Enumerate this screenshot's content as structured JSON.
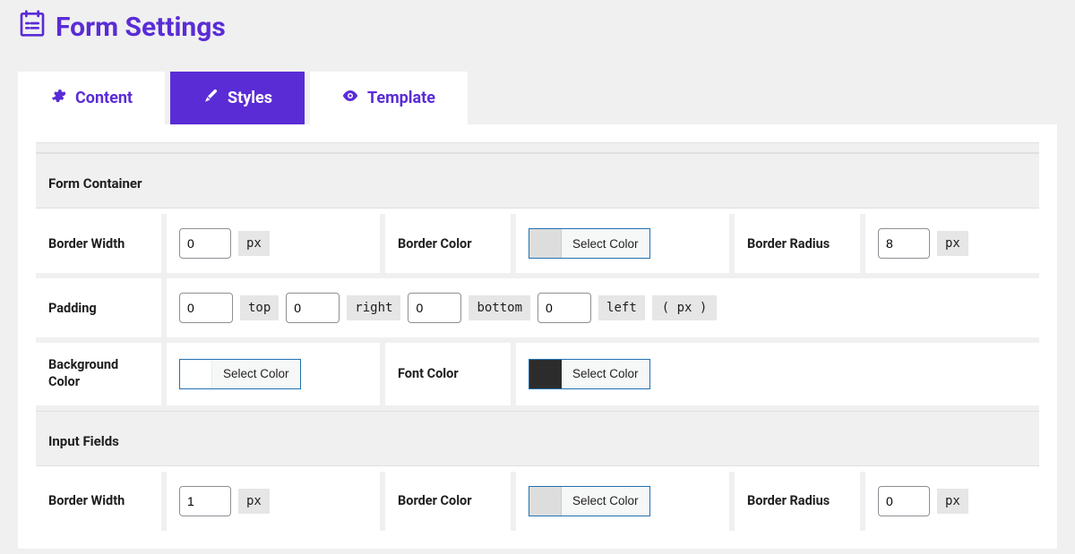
{
  "header": {
    "title": "Form Settings"
  },
  "tabs": {
    "content": "Content",
    "styles": "Styles",
    "template": "Template"
  },
  "sections": {
    "formContainer": {
      "title": "Form Container",
      "borderWidth": {
        "label": "Border Width",
        "value": "0",
        "unit": "px"
      },
      "borderColor": {
        "label": "Border Color",
        "button": "Select Color"
      },
      "borderRadius": {
        "label": "Border Radius",
        "value": "8",
        "unit": "px"
      },
      "padding": {
        "label": "Padding",
        "top": {
          "value": "0",
          "side": "top"
        },
        "right": {
          "value": "0",
          "side": "right"
        },
        "bottom": {
          "value": "0",
          "side": "bottom"
        },
        "left": {
          "value": "0",
          "side": "left"
        },
        "unitParen": "( px )"
      },
      "bgColor": {
        "label": "Background Color",
        "button": "Select Color"
      },
      "fontColor": {
        "label": "Font Color",
        "button": "Select Color"
      }
    },
    "inputFields": {
      "title": "Input Fields",
      "borderWidth": {
        "label": "Border Width",
        "value": "1",
        "unit": "px"
      },
      "borderColor": {
        "label": "Border Color",
        "button": "Select Color"
      },
      "borderRadius": {
        "label": "Border Radius",
        "value": "0",
        "unit": "px"
      }
    }
  }
}
